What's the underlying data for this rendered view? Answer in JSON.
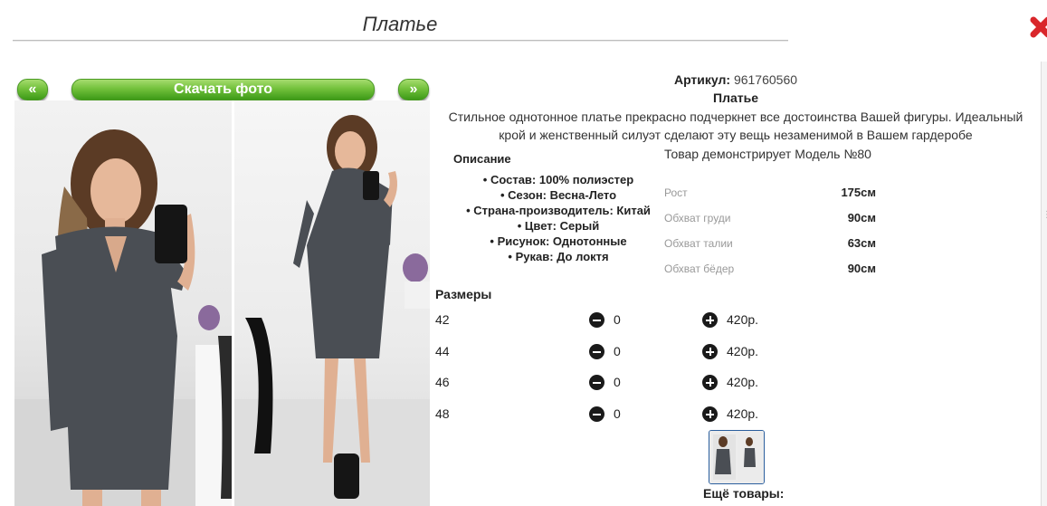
{
  "header": {
    "title": "Платье"
  },
  "gallery": {
    "prev_label": "«",
    "download_label": "Скачать фото",
    "next_label": "»"
  },
  "product": {
    "article_label": "Артикул:",
    "article_value": "961760560",
    "name": "Платье",
    "description_line1": "Стильное однотонное платье прекрасно подчеркнет все достоинства Вашей фигуры. Идеальный",
    "description_line2": "крой и женственный силуэт сделают эту вещь незаменимой в Вашем гардеробе"
  },
  "specs": {
    "heading": "Описание",
    "items": [
      "Состав: 100% полиэстер",
      "Сезон: Весна-Лето",
      "Страна-производитель: Китай",
      "Цвет: Серый",
      "Рисунок: Однотонные",
      "Рукав: До локтя"
    ]
  },
  "model": {
    "title": "Товар демонстрирует Модель №80",
    "rows": [
      {
        "label": "Рост",
        "value": "175см"
      },
      {
        "label": "Обхват груди",
        "value": "90см"
      },
      {
        "label": "Обхват талии",
        "value": "63см"
      },
      {
        "label": "Обхват бёдер",
        "value": "90см"
      }
    ]
  },
  "sizes": {
    "heading": "Размеры",
    "rows": [
      {
        "size": "42",
        "qty": "0",
        "price": "420р."
      },
      {
        "size": "44",
        "qty": "0",
        "price": "420р."
      },
      {
        "size": "46",
        "qty": "0",
        "price": "420р."
      },
      {
        "size": "48",
        "qty": "0",
        "price": "420р."
      }
    ]
  },
  "more_products_label": "Ещё товары:",
  "colors": {
    "accent_green": "#5fb52d",
    "close_red": "#d9262b",
    "dress_gray": "#4a4e54"
  }
}
